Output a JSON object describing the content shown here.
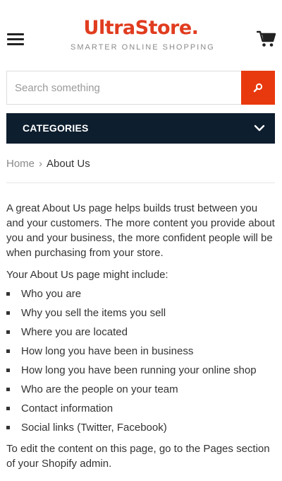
{
  "header": {
    "menu_icon": "hamburger-menu-icon",
    "logo_name": "UltraStore.",
    "logo_tagline": "SMARTER ONLINE SHOPPING",
    "cart_icon": "cart-icon",
    "brand_color": "#e03c1f"
  },
  "search": {
    "placeholder": "Search something",
    "value": "",
    "button_icon": "search-icon",
    "button_color": "#e8390e"
  },
  "categories": {
    "label": "CATEGORIES",
    "icon": "chevron-down-icon",
    "background": "#0d1e2e"
  },
  "breadcrumb": {
    "home": "Home",
    "separator": "›",
    "current": "About Us"
  },
  "content": {
    "intro": "A great About Us page helps builds trust between you and your customers. The more content you provide about you and your business, the more confident people will be when purchasing from your store.",
    "list_heading": "Your About Us page might include:",
    "items": [
      "Who you are",
      "Why you sell the items you sell",
      "Where you are located",
      "How long you have been in business",
      "How long you have been running your online shop",
      "Who are the people on your team",
      "Contact information",
      "Social links (Twitter, Facebook)"
    ],
    "outro": "To edit the content on this page, go to the Pages section of your Shopify admin."
  }
}
